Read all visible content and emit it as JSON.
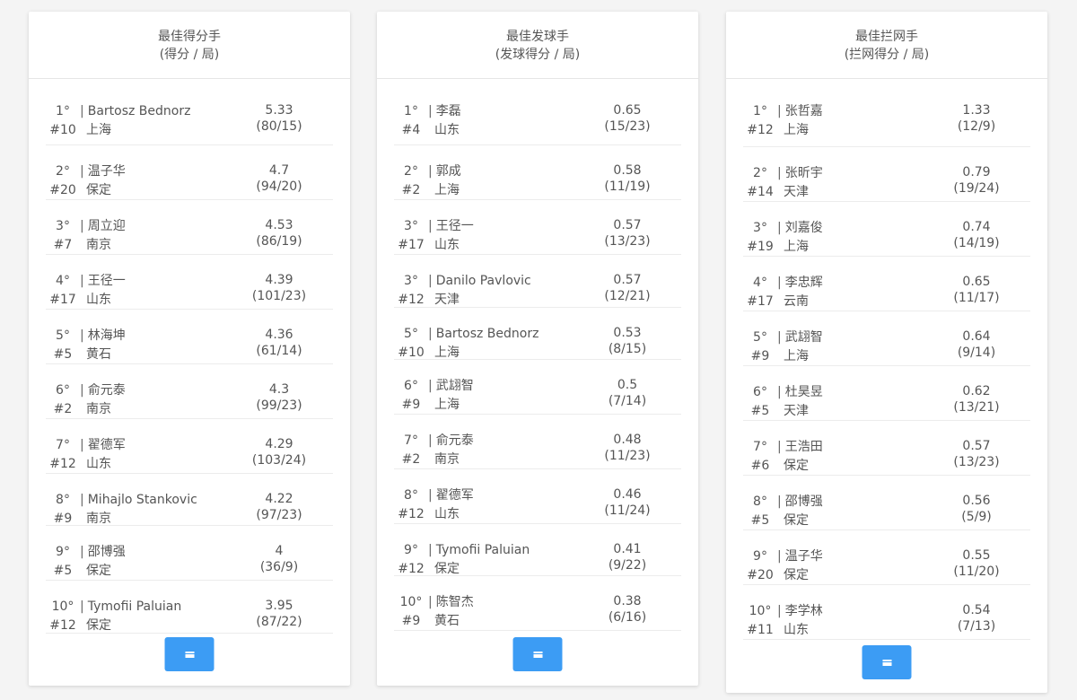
{
  "cards": [
    {
      "title": "最佳得分手",
      "subtitle": "(得分 / 局)",
      "rows": [
        {
          "rank": "1°",
          "number": "#10",
          "name": "Bartosz Bednorz",
          "team": "上海",
          "value": "5.33",
          "ratio": "(80/15)"
        },
        {
          "rank": "2°",
          "number": "#20",
          "name": "温子华",
          "team": "保定",
          "value": "4.7",
          "ratio": "(94/20)"
        },
        {
          "rank": "3°",
          "number": "#7",
          "name": "周立迎",
          "team": "南京",
          "value": "4.53",
          "ratio": "(86/19)"
        },
        {
          "rank": "4°",
          "number": "#17",
          "name": "王径一",
          "team": "山东",
          "value": "4.39",
          "ratio": "(101/23)"
        },
        {
          "rank": "5°",
          "number": "#5",
          "name": "林海坤",
          "team": "黄石",
          "value": "4.36",
          "ratio": "(61/14)"
        },
        {
          "rank": "6°",
          "number": "#2",
          "name": "俞元泰",
          "team": "南京",
          "value": "4.3",
          "ratio": "(99/23)"
        },
        {
          "rank": "7°",
          "number": "#12",
          "name": "翟德军",
          "team": "山东",
          "value": "4.29",
          "ratio": "(103/24)"
        },
        {
          "rank": "8°",
          "number": "#9",
          "name": "Mihajlo Stankovic",
          "team": "南京",
          "value": "4.22",
          "ratio": "(97/23)"
        },
        {
          "rank": "9°",
          "number": "#5",
          "name": "邵博强",
          "team": "保定",
          "value": "4",
          "ratio": "(36/9)"
        },
        {
          "rank": "10°",
          "number": "#12",
          "name": "Tymofii Paluian",
          "team": "保定",
          "value": "3.95",
          "ratio": "(87/22)"
        }
      ]
    },
    {
      "title": "最佳发球手",
      "subtitle": "(发球得分 / 局)",
      "rows": [
        {
          "rank": "1°",
          "number": "#4",
          "name": "李磊",
          "team": "山东",
          "value": "0.65",
          "ratio": "(15/23)"
        },
        {
          "rank": "2°",
          "number": "#2",
          "name": "郭成",
          "team": "上海",
          "value": "0.58",
          "ratio": "(11/19)"
        },
        {
          "rank": "3°",
          "number": "#17",
          "name": "王径一",
          "team": "山东",
          "value": "0.57",
          "ratio": "(13/23)"
        },
        {
          "rank": "3°",
          "number": "#12",
          "name": "Danilo Pavlovic",
          "team": "天津",
          "value": "0.57",
          "ratio": "(12/21)"
        },
        {
          "rank": "5°",
          "number": "#10",
          "name": "Bartosz Bednorz",
          "team": "上海",
          "value": "0.53",
          "ratio": "(8/15)"
        },
        {
          "rank": "6°",
          "number": "#9",
          "name": "武翃智",
          "team": "上海",
          "value": "0.5",
          "ratio": "(7/14)"
        },
        {
          "rank": "7°",
          "number": "#2",
          "name": "俞元泰",
          "team": "南京",
          "value": "0.48",
          "ratio": "(11/23)"
        },
        {
          "rank": "8°",
          "number": "#12",
          "name": "翟德军",
          "team": "山东",
          "value": "0.46",
          "ratio": "(11/24)"
        },
        {
          "rank": "9°",
          "number": "#12",
          "name": "Tymofii Paluian",
          "team": "保定",
          "value": "0.41",
          "ratio": "(9/22)"
        },
        {
          "rank": "10°",
          "number": "#9",
          "name": "陈智杰",
          "team": "黄石",
          "value": "0.38",
          "ratio": "(6/16)"
        }
      ]
    },
    {
      "title": "最佳拦网手",
      "subtitle": "(拦网得分 / 局)",
      "rows": [
        {
          "rank": "1°",
          "number": "#12",
          "name": "张哲嘉",
          "team": "上海",
          "value": "1.33",
          "ratio": "(12/9)"
        },
        {
          "rank": "2°",
          "number": "#14",
          "name": "张昕宇",
          "team": "天津",
          "value": "0.79",
          "ratio": "(19/24)"
        },
        {
          "rank": "3°",
          "number": "#19",
          "name": "刘嘉俊",
          "team": "上海",
          "value": "0.74",
          "ratio": "(14/19)"
        },
        {
          "rank": "4°",
          "number": "#17",
          "name": "李忠辉",
          "team": "云南",
          "value": "0.65",
          "ratio": "(11/17)"
        },
        {
          "rank": "5°",
          "number": "#9",
          "name": "武翃智",
          "team": "上海",
          "value": "0.64",
          "ratio": "(9/14)"
        },
        {
          "rank": "6°",
          "number": "#5",
          "name": "杜昊昱",
          "team": "天津",
          "value": "0.62",
          "ratio": "(13/21)"
        },
        {
          "rank": "7°",
          "number": "#6",
          "name": "王浩田",
          "team": "保定",
          "value": "0.57",
          "ratio": "(13/23)"
        },
        {
          "rank": "8°",
          "number": "#5",
          "name": "邵博强",
          "team": "保定",
          "value": "0.56",
          "ratio": "(5/9)"
        },
        {
          "rank": "9°",
          "number": "#20",
          "name": "温子华",
          "team": "保定",
          "value": "0.55",
          "ratio": "(11/20)"
        },
        {
          "rank": "10°",
          "number": "#11",
          "name": "李学林",
          "team": "山东",
          "value": "0.54",
          "ratio": "(7/13)"
        }
      ]
    }
  ],
  "footer_button_icon": "menu-icon",
  "accent_color": "#3c9cf4"
}
